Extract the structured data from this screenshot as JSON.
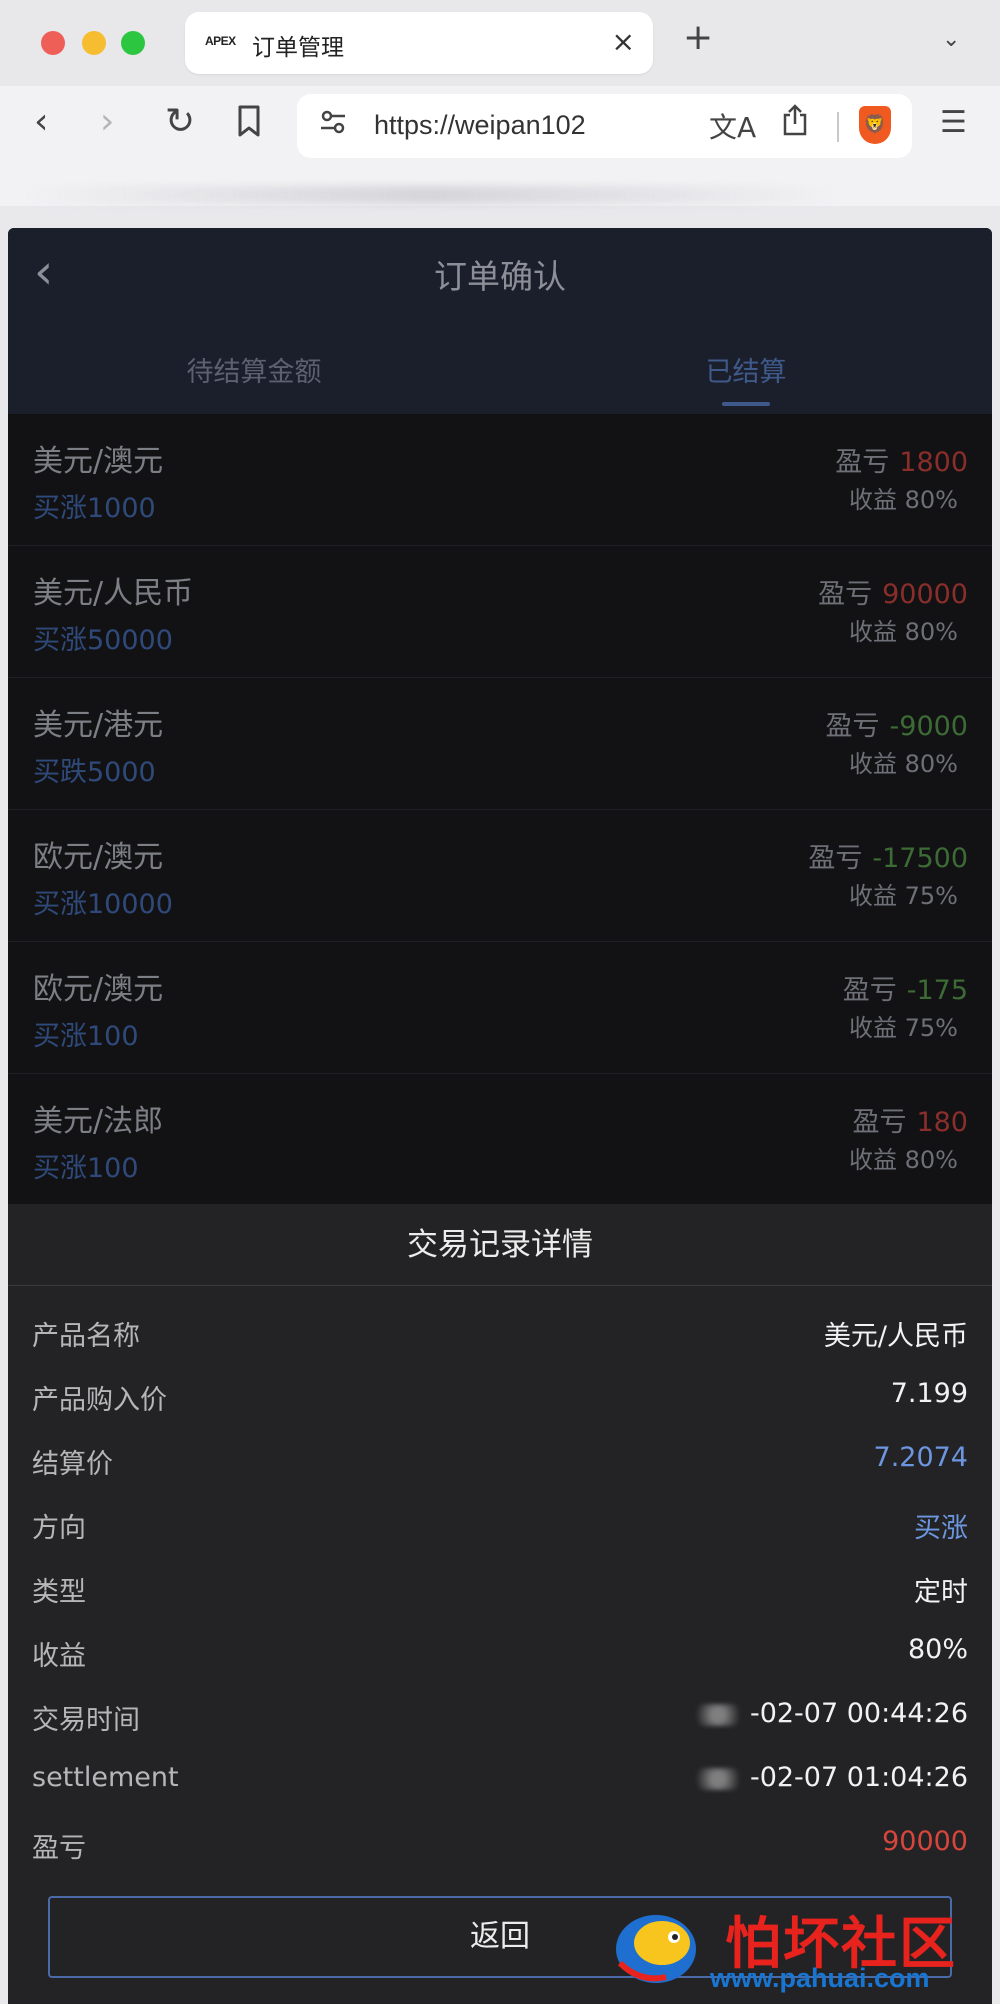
{
  "browser": {
    "tab": {
      "logo_text": "APEX",
      "title": "订单管理",
      "close": "×"
    },
    "new_tab": "+",
    "tab_menu": "⌄",
    "url": "https://weipan102",
    "translate_icon": "文A",
    "brave_icon": "🦁"
  },
  "page": {
    "title": "订单确认",
    "tabs": [
      {
        "label": "待结算金额",
        "active": false
      },
      {
        "label": "已结算",
        "active": true
      }
    ],
    "orders": [
      {
        "name": "美元/澳元",
        "direction": "买涨1000",
        "pnl_label": "盈亏",
        "pnl": "1800",
        "pnl_color": "red",
        "yield": "收益 80%"
      },
      {
        "name": "美元/人民币",
        "direction": "买涨50000",
        "pnl_label": "盈亏",
        "pnl": "90000",
        "pnl_color": "red",
        "yield": "收益 80%"
      },
      {
        "name": "美元/港元",
        "direction": "买跌5000",
        "pnl_label": "盈亏",
        "pnl": "-9000",
        "pnl_color": "green",
        "yield": "收益 80%"
      },
      {
        "name": "欧元/澳元",
        "direction": "买涨10000",
        "pnl_label": "盈亏",
        "pnl": "-17500",
        "pnl_color": "green",
        "yield": "收益 75%"
      },
      {
        "name": "欧元/澳元",
        "direction": "买涨100",
        "pnl_label": "盈亏",
        "pnl": "-175",
        "pnl_color": "green",
        "yield": "收益 75%"
      },
      {
        "name": "美元/法郎",
        "direction": "买涨100",
        "pnl_label": "盈亏",
        "pnl": "180",
        "pnl_color": "red",
        "yield": "收益 80%"
      }
    ]
  },
  "modal": {
    "title": "交易记录详情",
    "details": [
      {
        "label": "产品名称",
        "value": "美元/人民币",
        "style": ""
      },
      {
        "label": "产品购入价",
        "value": "7.199",
        "style": ""
      },
      {
        "label": "结算价",
        "value": "7.2074",
        "style": "blue"
      },
      {
        "label": "方向",
        "value": "买涨",
        "style": "blue"
      },
      {
        "label": "类型",
        "value": "定时",
        "style": ""
      },
      {
        "label": "收益",
        "value": "80%",
        "style": ""
      },
      {
        "label": "交易时间",
        "value": "-02-07 00:44:26",
        "style": ""
      },
      {
        "label": "settlement",
        "value": "-02-07 01:04:26",
        "style": ""
      },
      {
        "label": "盈亏",
        "value": "90000",
        "style": "red"
      }
    ],
    "return_label": "返回"
  },
  "watermark": {
    "title": "怕坏社区",
    "url": "www.pahuai.com"
  },
  "colors": {
    "red": "#8a2e2b",
    "green": "#3d6b35",
    "blue": "#6c97e0",
    "accent_red": "#d6463c"
  }
}
